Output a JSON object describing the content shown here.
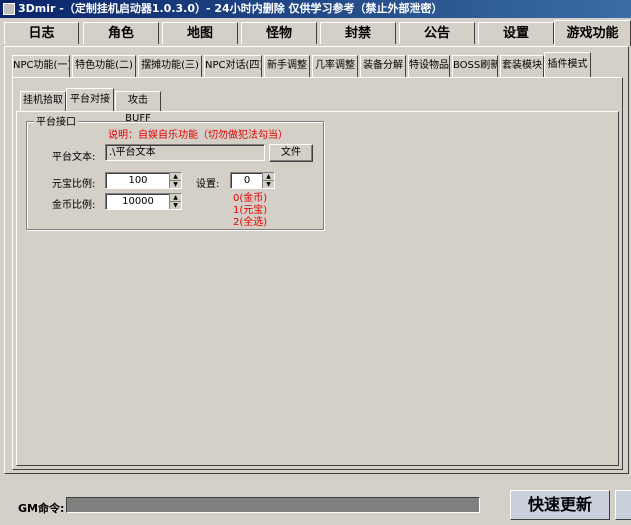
{
  "window": {
    "title": "3Dmir -（定制挂机启动器1.0.3.0）- 24小时内删除   仅供学习参考（禁止外部泄密）"
  },
  "main_tabs": [
    "日志",
    "角色",
    "地图",
    "怪物",
    "封禁",
    "公告",
    "设置",
    "游戏功能"
  ],
  "main_tab_active": "游戏功能",
  "sub_tabs": [
    "NPC功能(一)",
    "特色功能(二)",
    "摆摊功能(三)",
    "NPC对话(四)",
    "新手调整",
    "几率调整",
    "装备分解",
    "特设物品",
    "BOSS刷新",
    "套装模块",
    "插件模式"
  ],
  "sub_tab_active": "插件模式",
  "inner_tabs": [
    "挂机拾取",
    "平台对接",
    "攻击BUFF"
  ],
  "inner_tab_active": "平台对接",
  "platform": {
    "group_title": "平台接口",
    "note": "说明：自娱自乐功能（切勿做犯法勾当）",
    "text_label": "平台文本:",
    "text_value": ".\\平台文本",
    "file_button": "文件",
    "yuanbao_label": "元宝比例:",
    "yuanbao_value": "100",
    "gold_label": "金币比例:",
    "gold_value": "10000",
    "setting_label": "设置:",
    "setting_value": "0",
    "setting_options": [
      "0(金币)",
      "1(元宝)",
      "2(全选)"
    ]
  },
  "status": {
    "gm_label": "GM命令:",
    "gm_value": "",
    "quick_update": "快速更新"
  }
}
